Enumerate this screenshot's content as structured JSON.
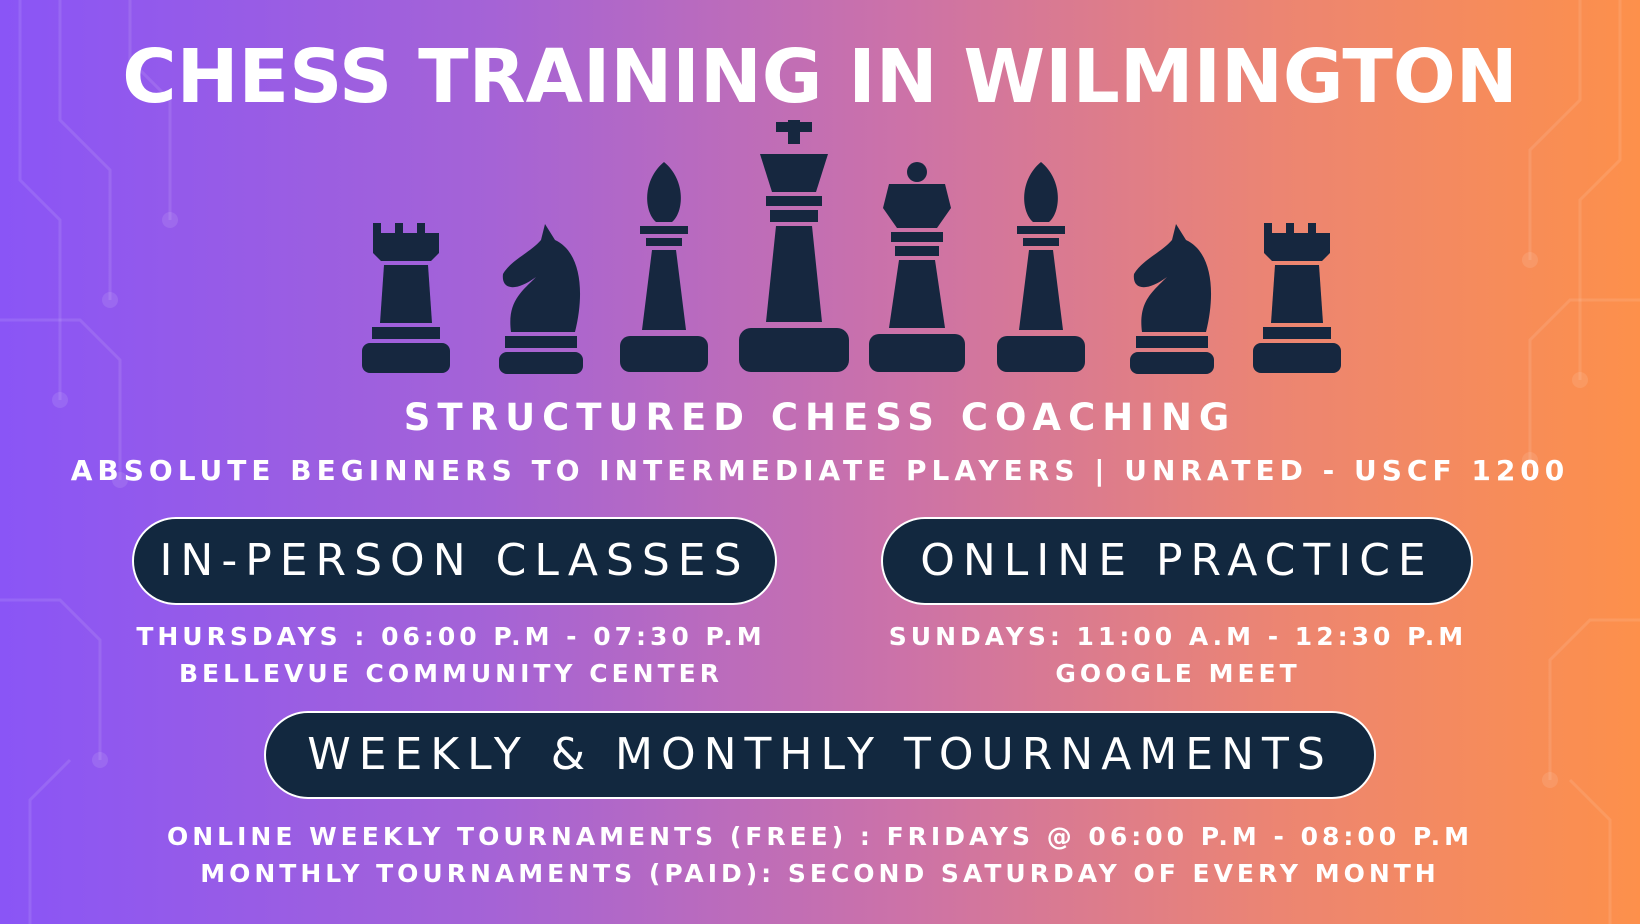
{
  "title": "CHESS TRAINING IN WILMINGTON",
  "pieces": [
    "rook-icon",
    "knight-icon",
    "bishop-icon",
    "king-icon",
    "queen-icon",
    "bishop-icon",
    "knight-icon",
    "rook-icon"
  ],
  "subtitle": "STRUCTURED CHESS COACHING",
  "audience": "ABSOLUTE BEGINNERS TO INTERMEDIATE PLAYERS | UNRATED - USCF 1200",
  "in_person": {
    "label": "IN-PERSON CLASSES",
    "schedule": "THURSDAYS : 06:00 P.M - 07:30 P.M",
    "location": "BELLEVUE COMMUNITY CENTER"
  },
  "online": {
    "label": "ONLINE PRACTICE",
    "schedule": "SUNDAYS: 11:00 A.M - 12:30 P.M",
    "location": "GOOGLE MEET"
  },
  "tournaments": {
    "label": "WEEKLY & MONTHLY TOURNAMENTS",
    "weekly": "ONLINE WEEKLY TOURNAMENTS (FREE) : FRIDAYS @ 06:00 P.M - 08:00 P.M",
    "monthly": "MONTHLY TOURNAMENTS (PAID): SECOND SATURDAY OF EVERY MONTH"
  },
  "colors": {
    "piece": "#16273f",
    "pill": "#12283f",
    "gradient_left": "#8a55f6",
    "gradient_right": "#fd904b",
    "text": "#ffffff"
  }
}
